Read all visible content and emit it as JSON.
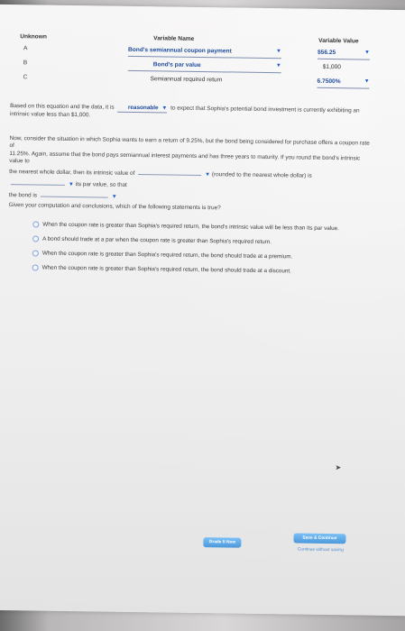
{
  "table": {
    "headers": {
      "unknown": "Unknown",
      "variable_name": "Variable Name",
      "variable_value": "Variable Value"
    },
    "rows": [
      {
        "letter": "A",
        "name": "Bond's semiannual coupon payment",
        "value": "$56.25"
      },
      {
        "letter": "B",
        "name": "Bond's par value",
        "value": "$1,000"
      },
      {
        "letter": "C",
        "name": "Semiannual required return",
        "value": "6.7500%"
      }
    ]
  },
  "paragraph1": {
    "before": "Based on this equation and the data, it is",
    "dropdown": "reasonable",
    "after": "to expect that Sophia's potential bond investment is currently exhibiting an intrinsic value less than $1,000."
  },
  "paragraph2": {
    "line1": "Now, consider the situation in which Sophia wants to earn a return of 9.25%, but the bond being considered for purchase offers a coupon rate of",
    "line2": "11.25%. Again, assume that the bond pays semiannual interest payments and has three years to maturity. If you round the bond's intrinsic value to",
    "line3_a": "the nearest whole dollar, then its intrinsic value of",
    "line3_b": "(rounded to the nearest whole dollar) is",
    "line3_c": "its par value, so that",
    "line4": "the bond is"
  },
  "question": "Given your computation and conclusions, which of the following statements is true?",
  "options": [
    "When the coupon rate is greater than Sophia's required return, the bond's intrinsic value will be less than its par value.",
    "A bond should trade at a par when the coupon rate is greater than Sophia's required return.",
    "When the coupon rate is greater than Sophia's required return, the bond should trade at a premium.",
    "When the coupon rate is greater than Sophia's required return, the bond should trade at a discount."
  ],
  "buttons": {
    "grade": "Grade It Now",
    "save": "Save & Continue",
    "continue": "Continue without saving"
  },
  "colors": {
    "accent": "#4b98da",
    "dropdown_text": "#1e4b9c"
  },
  "icons": {
    "dropdown": "chevron-down-icon",
    "radio": "radio-button-icon",
    "cursor": "mouse-pointer-icon"
  }
}
